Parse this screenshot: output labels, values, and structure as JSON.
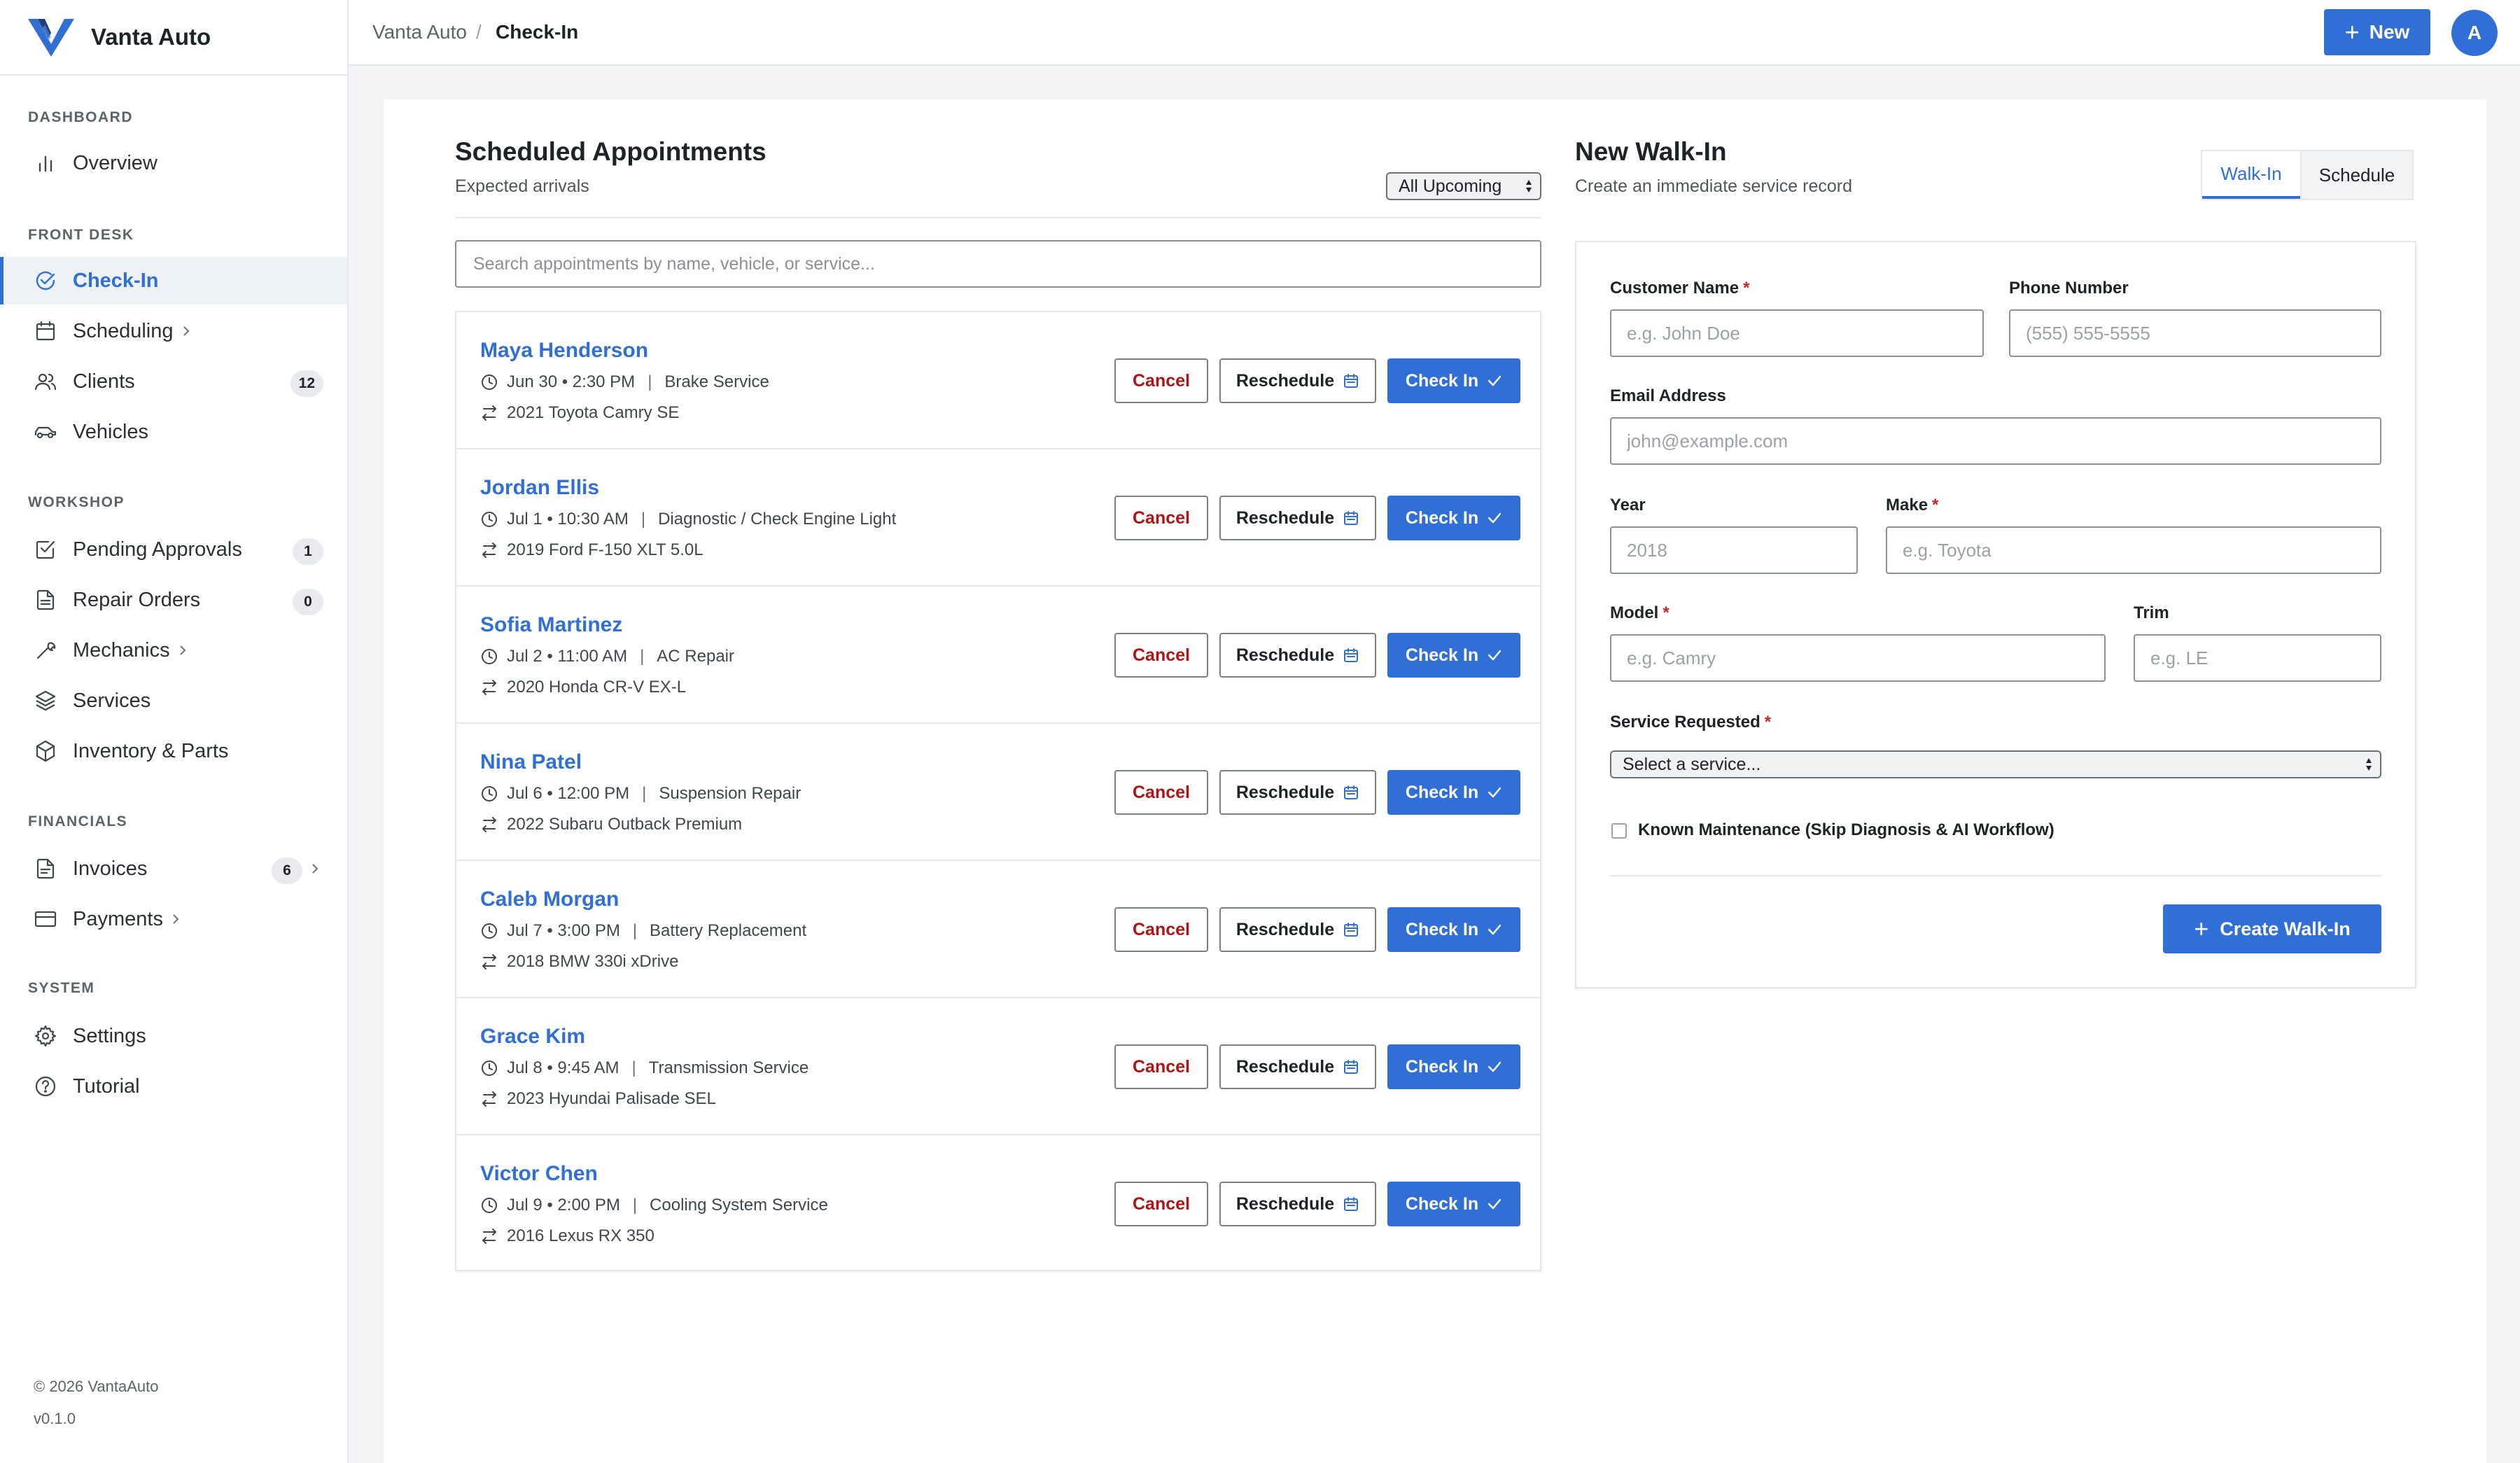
{
  "app": {
    "name": "Vanta Auto",
    "accent": "#2f6fd6"
  },
  "breadcrumb": {
    "root": "Vanta Auto",
    "separator": "/",
    "current": "Check-In"
  },
  "topbar": {
    "new_label": "New",
    "avatar_initial": "A"
  },
  "sidebar": {
    "sections": [
      {
        "title": "DASHBOARD"
      },
      {
        "title": "FRONT DESK"
      },
      {
        "title": "WORKSHOP"
      },
      {
        "title": "FINANCIALS"
      },
      {
        "title": "SYSTEM"
      }
    ],
    "items": [
      {
        "label": "Overview",
        "icon": "bar-chart-icon"
      },
      {
        "label": "Check-In",
        "icon": "check-circle-icon",
        "active": true
      },
      {
        "label": "Scheduling",
        "icon": "calendar-icon"
      },
      {
        "label": "Clients",
        "icon": "users-icon",
        "badge": "12"
      },
      {
        "label": "Vehicles",
        "icon": "car-icon"
      },
      {
        "label": "Pending Approvals",
        "icon": "checkbox-icon",
        "badge": "1"
      },
      {
        "label": "Repair Orders",
        "icon": "document-icon",
        "badge": "0"
      },
      {
        "label": "Mechanics",
        "icon": "wrench-icon"
      },
      {
        "label": "Services",
        "icon": "layers-icon"
      },
      {
        "label": "Inventory & Parts",
        "icon": "box-icon"
      },
      {
        "label": "Invoices",
        "icon": "invoice-icon",
        "badge": "6"
      },
      {
        "label": "Payments",
        "icon": "credit-card-icon"
      },
      {
        "label": "Settings",
        "icon": "gear-icon"
      },
      {
        "label": "Tutorial",
        "icon": "help-circle-icon"
      }
    ],
    "footer_copyright": "© 2026 VantaAuto",
    "footer_version": "v0.1.0"
  },
  "appointments": {
    "title": "Scheduled Appointments",
    "subtitle": "Expected arrivals",
    "filter_value": "All Upcoming",
    "search_placeholder": "Search appointments by name, vehicle, or service...",
    "actions": {
      "cancel": "Cancel",
      "reschedule": "Reschedule",
      "check_in": "Check In"
    },
    "items": [
      {
        "name": "Maya Henderson",
        "datetime": "Jun 30 • 2:30 PM",
        "service": "Brake Service",
        "vehicle": "2021 Toyota Camry SE"
      },
      {
        "name": "Jordan Ellis",
        "datetime": "Jul 1 • 10:30 AM",
        "service": "Diagnostic / Check Engine Light",
        "vehicle": "2019 Ford F-150 XLT 5.0L"
      },
      {
        "name": "Sofia Martinez",
        "datetime": "Jul 2 • 11:00 AM",
        "service": "AC Repair",
        "vehicle": "2020 Honda CR-V EX-L"
      },
      {
        "name": "Nina Patel",
        "datetime": "Jul 6 • 12:00 PM",
        "service": "Suspension Repair",
        "vehicle": "2022 Subaru Outback Premium"
      },
      {
        "name": "Caleb Morgan",
        "datetime": "Jul 7 • 3:00 PM",
        "service": "Battery Replacement",
        "vehicle": "2018 BMW 330i xDrive"
      },
      {
        "name": "Grace Kim",
        "datetime": "Jul 8 • 9:45 AM",
        "service": "Transmission Service",
        "vehicle": "2023 Hyundai Palisade SEL"
      },
      {
        "name": "Victor Chen",
        "datetime": "Jul 9 • 2:00 PM",
        "service": "Cooling System Service",
        "vehicle": "2016 Lexus RX 350"
      }
    ]
  },
  "walkin": {
    "title": "New Walk-In",
    "subtitle": "Create an immediate service record",
    "tabs": [
      {
        "label": "Walk-In",
        "active": true
      },
      {
        "label": "Schedule",
        "active": false
      }
    ],
    "required_mark": "*",
    "fields": {
      "customer_name": {
        "label": "Customer Name",
        "placeholder": "e.g. John Doe"
      },
      "phone": {
        "label": "Phone Number",
        "placeholder": "(555) 555-5555"
      },
      "email": {
        "label": "Email Address",
        "placeholder": "john@example.com"
      },
      "year": {
        "label": "Year",
        "placeholder": "2018"
      },
      "make": {
        "label": "Make",
        "placeholder": "e.g. Toyota"
      },
      "model": {
        "label": "Model",
        "placeholder": "e.g. Camry"
      },
      "trim": {
        "label": "Trim",
        "placeholder": "e.g. LE"
      },
      "service": {
        "label": "Service Requested",
        "value": "Select a service..."
      }
    },
    "known_maintenance_label": "Known Maintenance (Skip Diagnosis & AI Workflow)",
    "known_maintenance_checked": false,
    "create_label": "Create Walk-In"
  }
}
